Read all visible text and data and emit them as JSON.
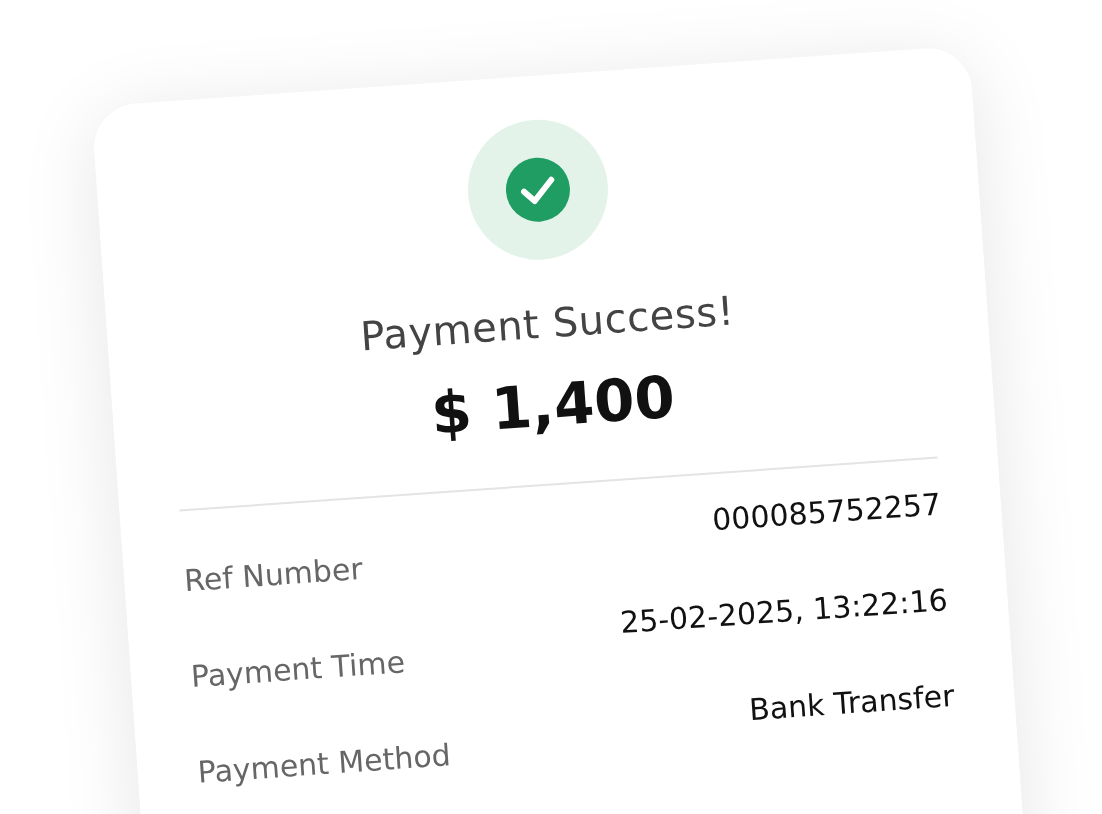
{
  "status": {
    "title": "Payment Success!",
    "amount": "$ 1,400"
  },
  "details": [
    {
      "label": "Ref Number",
      "value": "000085752257"
    },
    {
      "label": "Payment Time",
      "value": "25-02-2025, 13:22:16"
    },
    {
      "label": "Payment Method",
      "value": "Bank Transfer"
    }
  ]
}
